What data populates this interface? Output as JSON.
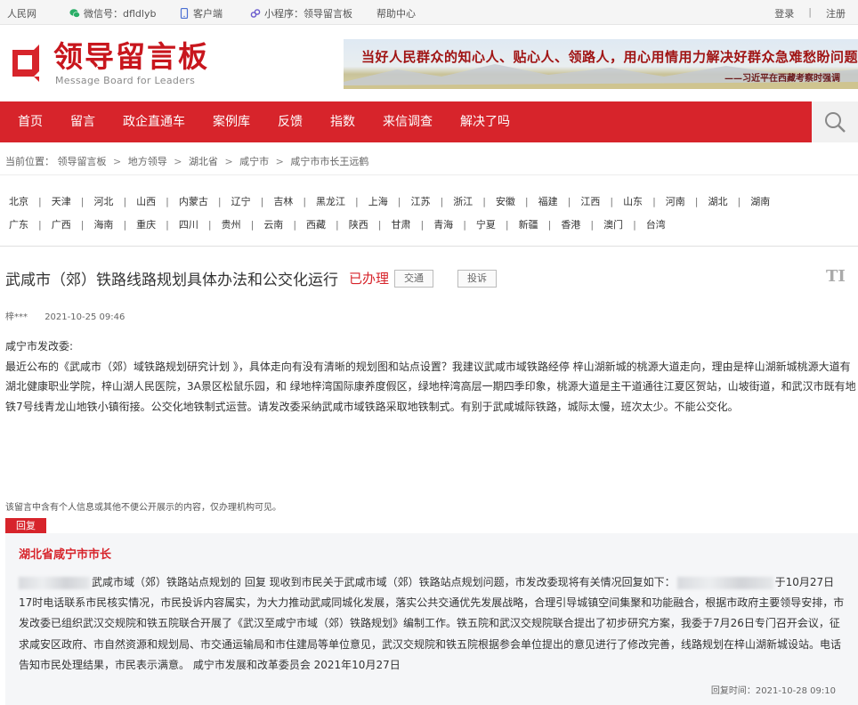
{
  "topbar": {
    "site": "人民网",
    "wechat": "微信号：dfldlyb",
    "client": "客户端",
    "miniprogram": "小程序：领导留言板",
    "help": "帮助中心",
    "login": "登录",
    "separator": "|",
    "register": "注册",
    "colors": {
      "wechat_icon": "#2aae67",
      "client_icon": "#4a6fd3",
      "miniprogram_icon": "#6a5acd"
    }
  },
  "header": {
    "logo_cn": "领导留言板",
    "logo_en": "Message Board for Leaders",
    "banner_slogan": "当好人民群众的知心人、贴心人、领路人，用心用情用力解决好群众急难愁盼问题。",
    "banner_quote": "——习近平在西藏考察时强调",
    "brand_color": "#d7242b"
  },
  "nav": {
    "items": [
      "首页",
      "留言",
      "政企直通车",
      "案例库",
      "反馈",
      "指数",
      "来信调查",
      "解决了吗"
    ],
    "search_icon": "search-icon"
  },
  "breadcrumb": {
    "prefix": "当前位置：",
    "items": [
      "领导留言板",
      "地方领导",
      "湖北省",
      "咸宁市",
      "咸宁市市长王远鹤"
    ],
    "separator": ">"
  },
  "provinces": {
    "row1": [
      "北京",
      "天津",
      "河北",
      "山西",
      "内蒙古",
      "辽宁",
      "吉林",
      "黑龙江",
      "上海",
      "江苏",
      "浙江",
      "安徽",
      "福建",
      "江西",
      "山东",
      "河南",
      "湖北",
      "湖南"
    ],
    "row2": [
      "广东",
      "广西",
      "海南",
      "重庆",
      "四川",
      "贵州",
      "云南",
      "西藏",
      "陕西",
      "甘肃",
      "青海",
      "宁夏",
      "新疆",
      "香港",
      "澳门",
      "台湾"
    ],
    "separator": "|"
  },
  "message": {
    "title": "武咸市（郊）铁路线路规划具体办法和公交化运行",
    "status": "已办理",
    "tag_transport": "交通",
    "tag_complaint": "投诉",
    "font_size_icon": "TI",
    "author": "梓***",
    "time": "2021-10-25 09:46",
    "salutation": "咸宁市发改委:",
    "body": "最近公布的《武咸市（郊）域铁路规划研究计划 》，具体走向有没有清晰的规划图和站点设置？我建议武咸市域铁路经停 梓山湖新城的桃源大道走向，理由是梓山湖新城桃源大道有湖北健康职业学院，梓山湖人民医院，3A景区松鼠乐园，和 绿地梓湾国际康养度假区，绿地梓湾高层一期四季印象，桃源大道是主干道通往江夏区贺站，山坡街道，和武汉市既有地铁7号线青龙山地铁小镇衔接。公交化地铁制式运营。请发改委采纳武咸市域铁路采取地铁制式。有别于武咸城际铁路，城际太慢，班次太少。不能公交化。",
    "notice": "该留言中含有个人信息或其他不便公开展示的内容，仅办理机构可见。"
  },
  "reply": {
    "tag": "回复",
    "leader": "湖北省咸宁市市长",
    "text_part1": "武咸市域（郊）铁路站点规划的 回复 现收到市民关于武咸市域（郊）铁路站点规划问题，市发改委现将有关情况回复如下：",
    "text_part2": "于10月27日17时电话联系市民核实情况，市民投诉内容属实，为大力推动武咸同城化发展，落实公共交通优先发展战略，合理引导城镇空间集聚和功能融合，根据市政府主要领导安排，市发改委已组织武汉交规院和铁五院联合开展了《武汉至咸宁市域（郊）铁路规划》编制工作。铁五院和武汉交规院联合提出了初步研究方案，我委于7月26日专门召开会议，征求咸安区政府、市自然资源和规划局、市交通运输局和市住建局等单位意见，武汉交规院和铁五院根据参会单位提出的意见进行了修改完善，线路规划在梓山湖新城设站。电话告知市民处理结果，市民表示满意。 咸宁市发展和改革委员会 2021年10月27日",
    "time": "回复时间：2021-10-28 09:10"
  }
}
